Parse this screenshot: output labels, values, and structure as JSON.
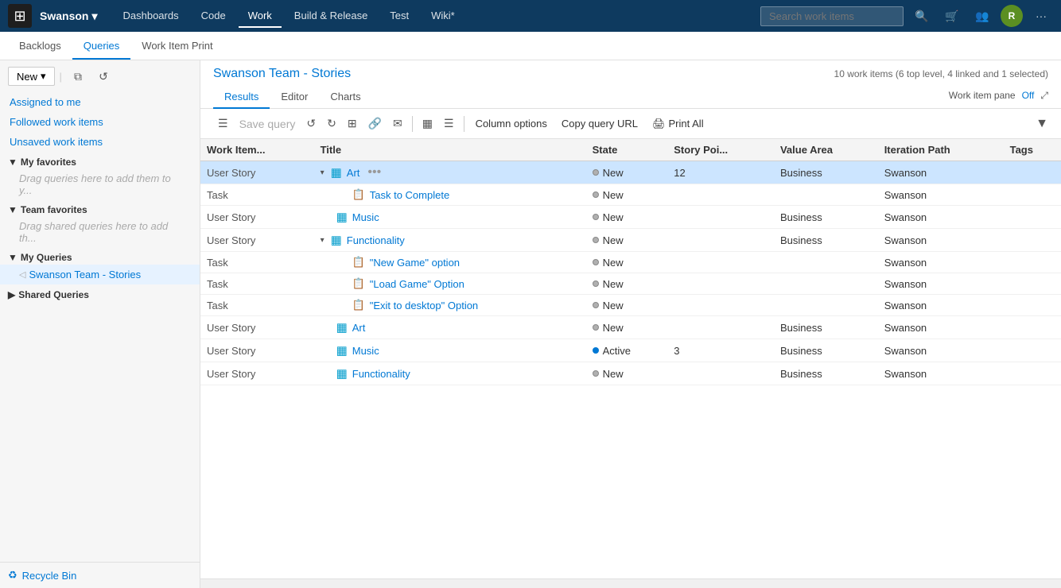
{
  "topnav": {
    "logo": "⊞",
    "project_name": "Swanson",
    "project_arrow": "▾",
    "links": [
      {
        "label": "Dashboards",
        "active": false
      },
      {
        "label": "Code",
        "active": false
      },
      {
        "label": "Work",
        "active": true
      },
      {
        "label": "Build & Release",
        "active": false
      },
      {
        "label": "Test",
        "active": false
      },
      {
        "label": "Wiki*",
        "active": false
      }
    ],
    "search_placeholder": "Search work items",
    "user_initials": "R",
    "more_label": "···"
  },
  "tabs": [
    {
      "label": "Backlogs",
      "active": false
    },
    {
      "label": "Queries",
      "active": true
    },
    {
      "label": "Work Item Print",
      "active": false
    }
  ],
  "sidebar": {
    "new_label": "New",
    "items": [
      {
        "label": "Assigned to me"
      },
      {
        "label": "Followed work items"
      },
      {
        "label": "Unsaved work items"
      }
    ],
    "sections": [
      {
        "label": "My favorites",
        "sub_text": "Drag queries here to add them to y..."
      },
      {
        "label": "Team favorites",
        "sub_text": "Drag shared queries here to add th..."
      },
      {
        "label": "My Queries",
        "queries": [
          {
            "label": "Swanson Team - Stories",
            "selected": true
          }
        ]
      },
      {
        "label": "Shared Queries",
        "queries": []
      }
    ],
    "recycle_bin_label": "Recycle Bin"
  },
  "panel": {
    "title_prefix": "Swanson ",
    "title_team": "Team",
    "title_suffix": " - Stories",
    "subtitle": "10 work items (6 top level, 4 linked and 1 selected)",
    "tabs": [
      {
        "label": "Results",
        "active": true
      },
      {
        "label": "Editor",
        "active": false
      },
      {
        "label": "Charts",
        "active": false
      }
    ],
    "work_item_pane_label": "Work item pane",
    "off_label": "Off"
  },
  "toolbar": {
    "save_query_label": "Save query",
    "column_options_label": "Column options",
    "copy_query_url_label": "Copy query URL",
    "print_all_label": "Print All"
  },
  "table": {
    "columns": [
      {
        "label": "Work Item..."
      },
      {
        "label": "Title"
      },
      {
        "label": "State"
      },
      {
        "label": "Story Poi..."
      },
      {
        "label": "Value Area"
      },
      {
        "label": "Iteration Path"
      },
      {
        "label": "Tags"
      }
    ],
    "rows": [
      {
        "type": "User Story",
        "collapsed": true,
        "icon_type": "story",
        "title": "Art",
        "state": "New",
        "state_type": "new",
        "story_points": "12",
        "value_area": "Business",
        "iteration": "Swanson",
        "tags": "",
        "selected": true,
        "has_ellipsis": true,
        "indent": 0
      },
      {
        "type": "Task",
        "collapsed": false,
        "icon_type": "task",
        "title": "Task to Complete",
        "state": "New",
        "state_type": "new",
        "story_points": "",
        "value_area": "",
        "iteration": "Swanson",
        "tags": "",
        "selected": false,
        "has_ellipsis": false,
        "indent": 1
      },
      {
        "type": "User Story",
        "collapsed": false,
        "icon_type": "story",
        "title": "Music",
        "state": "New",
        "state_type": "new",
        "story_points": "",
        "value_area": "Business",
        "iteration": "Swanson",
        "tags": "",
        "selected": false,
        "has_ellipsis": false,
        "indent": 0
      },
      {
        "type": "User Story",
        "collapsed": true,
        "icon_type": "story",
        "title": "Functionality",
        "state": "New",
        "state_type": "new",
        "story_points": "",
        "value_area": "Business",
        "iteration": "Swanson",
        "tags": "",
        "selected": false,
        "has_ellipsis": false,
        "indent": 0
      },
      {
        "type": "Task",
        "collapsed": false,
        "icon_type": "task",
        "title": "\"New Game\" option",
        "state": "New",
        "state_type": "new",
        "story_points": "",
        "value_area": "",
        "iteration": "Swanson",
        "tags": "",
        "selected": false,
        "has_ellipsis": false,
        "indent": 1
      },
      {
        "type": "Task",
        "collapsed": false,
        "icon_type": "task",
        "title": "\"Load Game\" Option",
        "state": "New",
        "state_type": "new",
        "story_points": "",
        "value_area": "",
        "iteration": "Swanson",
        "tags": "",
        "selected": false,
        "has_ellipsis": false,
        "indent": 1
      },
      {
        "type": "Task",
        "collapsed": false,
        "icon_type": "task",
        "title": "\"Exit to desktop\" Option",
        "state": "New",
        "state_type": "new",
        "story_points": "",
        "value_area": "",
        "iteration": "Swanson",
        "tags": "",
        "selected": false,
        "has_ellipsis": false,
        "indent": 1
      },
      {
        "type": "User Story",
        "collapsed": false,
        "icon_type": "story",
        "title": "Art",
        "state": "New",
        "state_type": "new",
        "story_points": "",
        "value_area": "Business",
        "iteration": "Swanson",
        "tags": "",
        "selected": false,
        "has_ellipsis": false,
        "indent": 0
      },
      {
        "type": "User Story",
        "collapsed": false,
        "icon_type": "story",
        "title": "Music",
        "state": "Active",
        "state_type": "active",
        "story_points": "3",
        "value_area": "Business",
        "iteration": "Swanson",
        "tags": "",
        "selected": false,
        "has_ellipsis": false,
        "indent": 0
      },
      {
        "type": "User Story",
        "collapsed": false,
        "icon_type": "story",
        "title": "Functionality",
        "state": "New",
        "state_type": "new",
        "story_points": "",
        "value_area": "Business",
        "iteration": "Swanson",
        "tags": "",
        "selected": false,
        "has_ellipsis": false,
        "indent": 0
      }
    ]
  }
}
